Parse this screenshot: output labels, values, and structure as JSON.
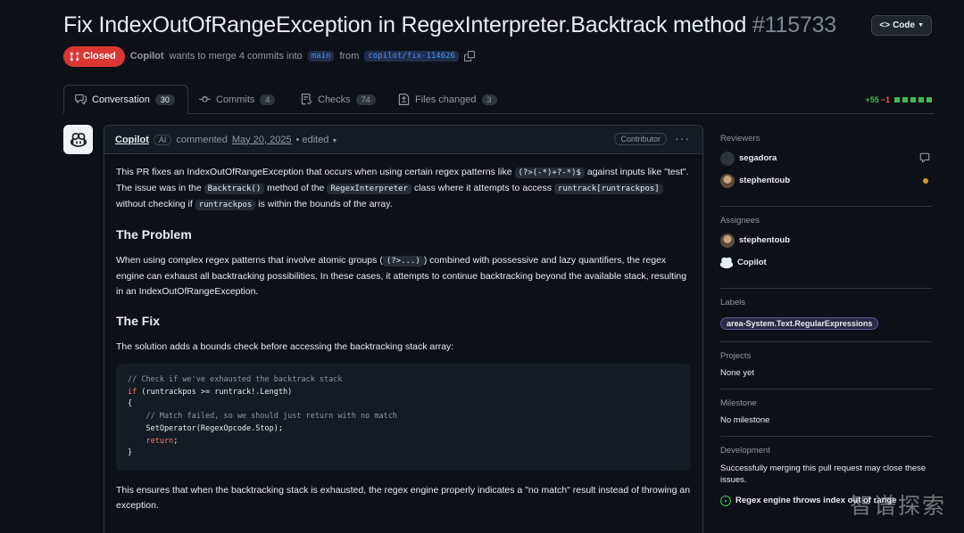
{
  "pr": {
    "title": "Fix IndexOutOfRangeException in RegexInterpreter.Backtrack method",
    "number": "#115733",
    "state": "Closed",
    "author": "Copilot",
    "merge_text": "wants to merge 4 commits into",
    "base_branch": "main",
    "from_text": "from",
    "head_branch": "copilot/fix-114626"
  },
  "code_button": {
    "label": "Code"
  },
  "tabs": [
    {
      "label": "Conversation",
      "count": "30"
    },
    {
      "label": "Commits",
      "count": "4"
    },
    {
      "label": "Checks",
      "count": "74"
    },
    {
      "label": "Files changed",
      "count": "3"
    }
  ],
  "diffstat": {
    "additions": "+55",
    "deletions": "−1"
  },
  "comment": {
    "author": "Copilot",
    "ai_badge": "AI",
    "commented": "commented",
    "date": "May 20, 2025",
    "edited": "• edited",
    "role": "Contributor",
    "p1_a": "This PR fixes an IndexOutOfRangeException that occurs when using certain regex patterns like",
    "p1_code1": "(?>(-*)+?-*)$",
    "p1_b": "against inputs like \"test\". The issue was in the",
    "p1_code2": "Backtrack()",
    "p1_c": "method of the",
    "p1_code3": "RegexInterpreter",
    "p1_d": "class where it attempts to access",
    "p1_code4": "runtrack[runtrackpos]",
    "p1_e": "without checking if",
    "p1_code5": "runtrackpos",
    "p1_f": "is within the bounds of the array.",
    "h_problem": "The Problem",
    "p2_a": "When using complex regex patterns that involve atomic groups (",
    "p2_code": "(?>...)",
    "p2_b": ") combined with possessive and lazy quantifiers, the regex engine can exhaust all backtracking possibilities. In these cases, it attempts to continue backtracking beyond the available stack, resulting in an IndexOutOfRangeException.",
    "h_fix": "The Fix",
    "p3": "The solution adds a bounds check before accessing the backtracking stack array:",
    "code": {
      "l1": "// Check if we've exhausted the backtrack stack",
      "l2_kw": "if",
      "l2_rest": " (runtrackpos >= runtrack!.Length)",
      "l3": "{",
      "l4": "    // Match failed, so we should just return with no match",
      "l5": "    SetOperator(RegexOpcode.Stop);",
      "l6_kw": "return",
      "l6_rest": ";",
      "l7": "}"
    },
    "p4": "This ensures that when the backtracking stack is exhausted, the regex engine properly indicates a \"no match\" result instead of throwing an exception."
  },
  "sidebar": {
    "reviewers_head": "Reviewers",
    "reviewers": [
      "segadora",
      "stephentoub"
    ],
    "assignees_head": "Assignees",
    "assignees": [
      "stephentoub",
      "Copilot"
    ],
    "labels_head": "Labels",
    "label": "area-System.Text.RegularExpressions",
    "projects_head": "Projects",
    "projects_value": "None yet",
    "milestone_head": "Milestone",
    "milestone_value": "No milestone",
    "development_head": "Development",
    "development_text": "Successfully merging this pull request may close these issues.",
    "linked_issue": "Regex engine throws index out of range"
  },
  "watermark": "智谱探索",
  "colors": {
    "closed": "#da3633",
    "add": "#3fb950",
    "del": "#f85149",
    "link": "#4493f8"
  }
}
